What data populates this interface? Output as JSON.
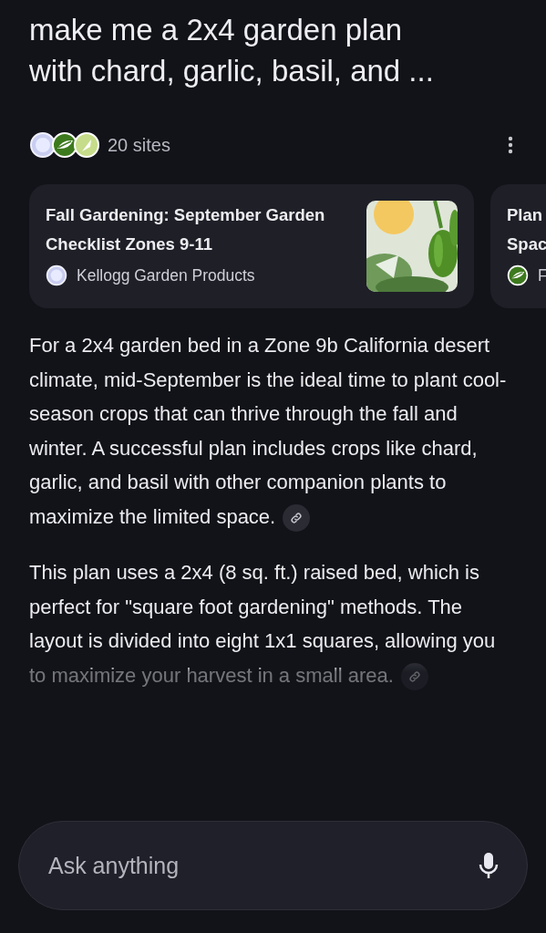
{
  "query": {
    "lines": [
      "make me a 2x4 garden plan",
      "with chard, garlic, basil, and ..."
    ]
  },
  "sources": {
    "favicons": [
      {
        "kind": "globe"
      },
      {
        "kind": "leaf"
      },
      {
        "kind": "sprout"
      }
    ],
    "count": "20 sites"
  },
  "cards": [
    {
      "title_lines": [
        "Fall Gardening: September Garden",
        "Checklist Zones 9-11"
      ],
      "site": "Kellogg Garden Products",
      "favicon": {
        "kind": "globe"
      },
      "has_picture": true
    },
    {
      "title_lines": [
        "Plan",
        "Spac"
      ],
      "site": "F",
      "favicon": {
        "kind": "leaf"
      },
      "has_picture": false
    }
  ],
  "paragraphs": [
    {
      "text": "For a 2x4 garden bed in a Zone 9b California desert climate, mid-September is the ideal time to plant cool-season crops that can thrive through the fall and winter. A successful plan includes crops like chard, garlic, and basil with other companion plants to maximize the limited space.",
      "faded": false
    },
    {
      "text": "This plan uses a 2x4 (8 sq. ft.) raised bed, which is perfect for \"square foot gardening\" methods. The layout is divided into eight 1x1 squares, allowing you to maximize your harvest in a small area.",
      "faded": true
    }
  ],
  "input": {
    "placeholder": "Ask anything"
  }
}
